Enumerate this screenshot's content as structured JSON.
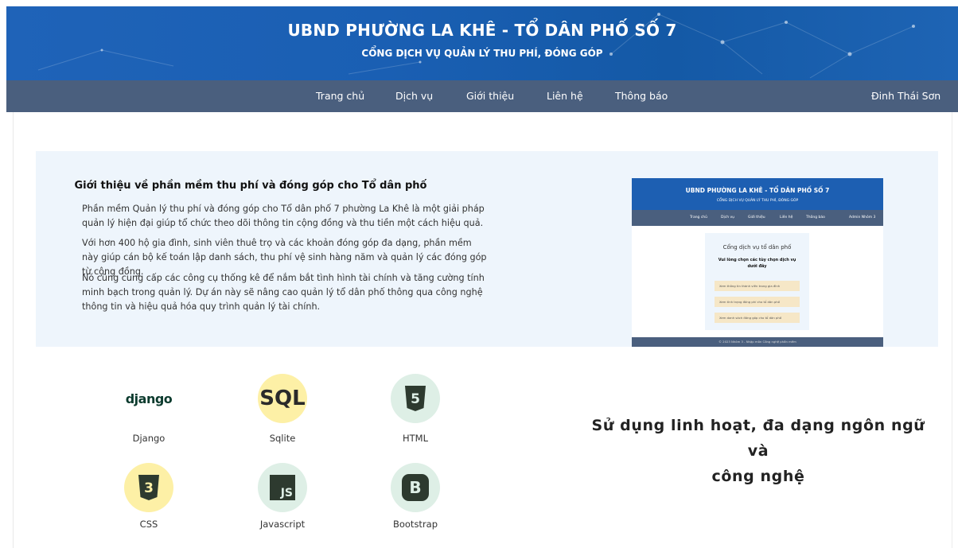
{
  "header": {
    "title": "UBND PHƯỜNG LA KHÊ - TỔ DÂN PHỐ SỐ 7",
    "subtitle": "CỔNG DỊCH VỤ QUẢN LÝ THU PHÍ, ĐÓNG GÓP"
  },
  "nav": {
    "items": [
      "Trang chủ",
      "Dịch vụ",
      "Giới thiệu",
      "Liên hệ",
      "Thông báo"
    ],
    "user": "Đinh Thái Sơn"
  },
  "intro": {
    "title": "Giới thiệu về phần mềm thu phí và đóng góp cho Tổ dân phố",
    "paragraphs": [
      "Phần mềm Quản lý thu phí và đóng góp cho Tổ dân phố 7 phường La Khê là một giải pháp quản lý hiện đại giúp tổ chức theo dõi thông tin cộng đồng và thu tiền một cách hiệu quả.",
      "Với hơn 400 hộ gia đình, sinh viên thuê trọ và các khoản đóng góp đa dạng, phần mềm này giúp cán bộ kế toán lập danh sách, thu phí vệ sinh hàng năm và quản lý các đóng góp từ cộng đồng.",
      "Nó cũng cung cấp các công cụ thống kê để nắm bắt tình hình tài chính và tăng cường tính minh bạch trong quản lý. Dự án này sẽ nâng cao quản lý tổ dân phố thông qua công nghệ thông tin và hiệu quả hóa quy trình quản lý tài chính."
    ]
  },
  "preview": {
    "title": "UBND PHƯỜNG LA KHÊ - TỔ DÂN PHỐ SỐ 7",
    "subtitle": "CỔNG DỊCH VỤ QUẢN LÝ THU PHÍ, ĐÓNG GÓP",
    "nav": [
      "Trang chủ",
      "Dịch vụ",
      "Giới thiệu",
      "Liên hệ",
      "Thông báo",
      "Admin Nhóm 3"
    ],
    "card_title": "Cổng dịch vụ tổ dân phố",
    "card_sub": "Vui lòng chọn các tùy chọn dịch vụ dưới đây",
    "buttons": [
      "Xem thông tin thành viên trong gia đình",
      "Xem tình trạng đóng phí cho tổ dân phố",
      "Xem danh sách đóng góp cho tổ dân phố"
    ],
    "footer": "© 2023 Nhóm 3 - Nhập môn Công nghệ phần mềm"
  },
  "tech": [
    {
      "label": "Django",
      "icon": "django-logo",
      "badge": "django"
    },
    {
      "label": "Sqlite",
      "icon": "sql-logo",
      "badge": "SQL"
    },
    {
      "label": "HTML",
      "icon": "html5-icon",
      "badge": "5"
    },
    {
      "label": "CSS",
      "icon": "css3-icon",
      "badge": "3"
    },
    {
      "label": "Javascript",
      "icon": "js-icon",
      "badge": "JS"
    },
    {
      "label": "Bootstrap",
      "icon": "bootstrap-icon",
      "badge": "B"
    }
  ],
  "slogan": {
    "line1": "Sử dụng linh hoạt, đa dạng ngôn ngữ và",
    "line2": "công nghệ"
  },
  "colors": {
    "banner": "#1a5fb3",
    "navbar": "#4a5f7e",
    "intro_bg": "#eef5fc",
    "mint_circle": "#deefe6",
    "yellow_circle": "#fdf0a6"
  }
}
